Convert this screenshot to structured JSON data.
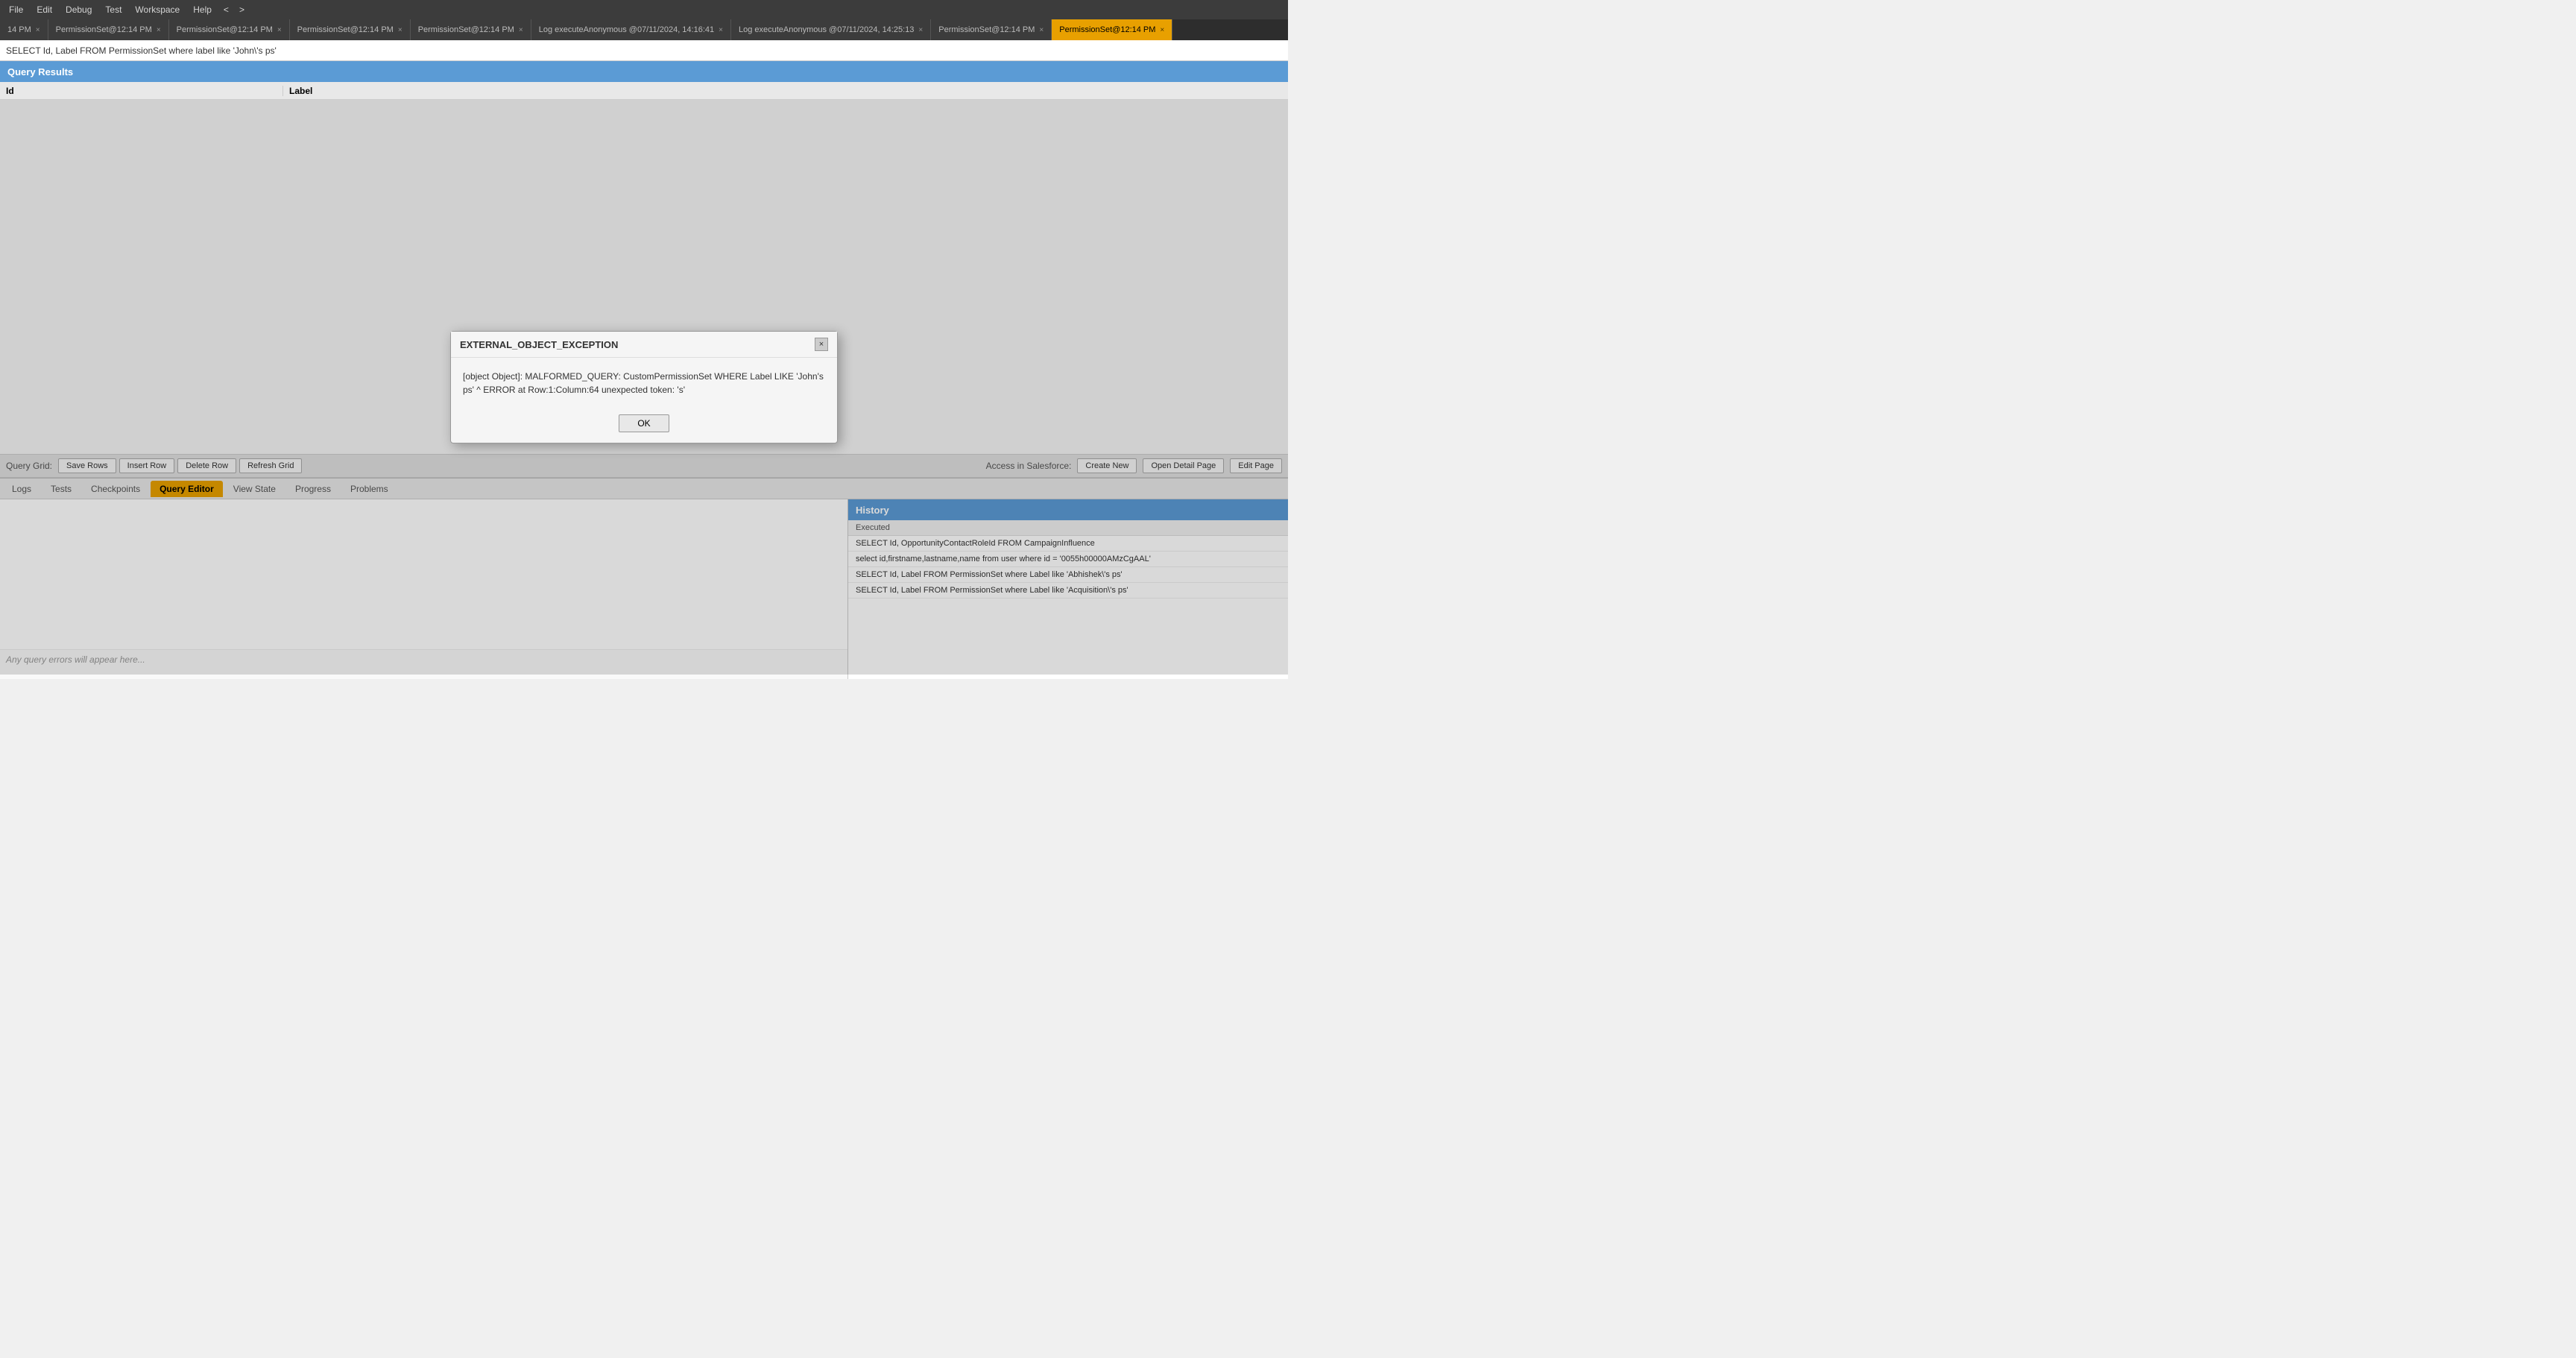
{
  "menu": {
    "items": [
      {
        "label": "File",
        "id": "file"
      },
      {
        "label": "Edit",
        "id": "edit"
      },
      {
        "label": "Debug",
        "id": "debug"
      },
      {
        "label": "Test",
        "id": "test"
      },
      {
        "label": "Workspace",
        "id": "workspace"
      },
      {
        "label": "Help",
        "id": "help"
      }
    ],
    "nav_back": "<",
    "nav_forward": ">"
  },
  "tabs": [
    {
      "label": "14 PM",
      "active": false
    },
    {
      "label": "PermissionSet@12:14 PM",
      "active": false
    },
    {
      "label": "PermissionSet@12:14 PM",
      "active": false
    },
    {
      "label": "PermissionSet@12:14 PM",
      "active": false
    },
    {
      "label": "PermissionSet@12:14 PM",
      "active": false
    },
    {
      "label": "Log executeAnonymous @07/11/2024, 14:16:41",
      "active": false
    },
    {
      "label": "Log executeAnonymous @07/11/2024, 14:25:13",
      "active": false
    },
    {
      "label": "PermissionSet@12:14 PM",
      "active": false
    },
    {
      "label": "PermissionSet@12:14 PM",
      "active": true
    }
  ],
  "sql_bar": {
    "value": "SELECT Id, Label FROM PermissionSet where label like 'John\\'s ps'"
  },
  "query_results": {
    "header": "Query Results",
    "columns": [
      {
        "label": "Id"
      },
      {
        "label": "Label"
      }
    ]
  },
  "dialog": {
    "title": "EXTERNAL_OBJECT_EXCEPTION",
    "message": "[object Object]: MALFORMED_QUERY: CustomPermissionSet WHERE Label LIKE 'John's ps' ^ ERROR at Row:1:Column:64 unexpected token: 's'",
    "ok_button": "OK"
  },
  "bottom_toolbar": {
    "query_grid_label": "Query Grid:",
    "save_rows": "Save Rows",
    "insert_row": "Insert Row",
    "delete_row": "Delete Row",
    "refresh_grid": "Refresh Grid",
    "access_label": "Access in Salesforce:",
    "create_new": "Create New",
    "open_detail_page": "Open Detail Page",
    "edit_page": "Edit Page"
  },
  "bottom_tabs": [
    {
      "label": "Logs",
      "active": false
    },
    {
      "label": "Tests",
      "active": false
    },
    {
      "label": "Checkpoints",
      "active": false
    },
    {
      "label": "Query Editor",
      "active": true
    },
    {
      "label": "View State",
      "active": false
    },
    {
      "label": "Progress",
      "active": false
    },
    {
      "label": "Problems",
      "active": false
    }
  ],
  "editor": {
    "query_value": "SELECT Id, Label FROM PermissionSet where label like 'John\\'s ps'",
    "error_placeholder": "Any query errors will appear here..."
  },
  "history": {
    "header": "History",
    "section_label": "Executed",
    "items": [
      "SELECT Id, OpportunityContactRoleId FROM CampaignInfluence",
      "select id,firstname,lastname,name from user where id = '0055h00000AMzCgAAL'",
      "SELECT Id, Label FROM PermissionSet where Label like 'Abhishek\\'s ps'",
      "SELECT Id, Label FROM PermissionSet where Label like 'Acquisition\\'s ps'"
    ]
  }
}
